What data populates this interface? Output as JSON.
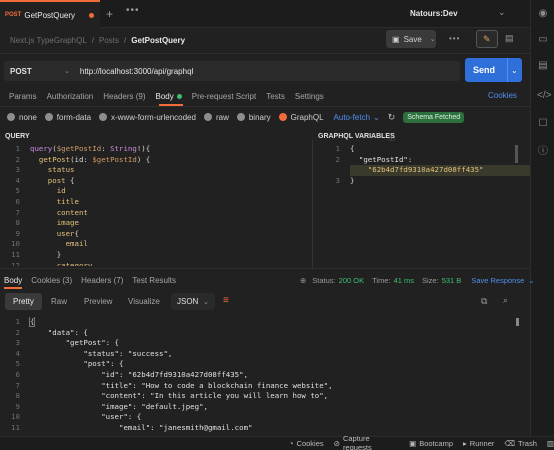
{
  "tab": {
    "method": "POST",
    "name": "GetPostQuery"
  },
  "workspace": "Natours:Dev",
  "breadcrumb": {
    "root": "Next.js TypeGraphQL",
    "folder": "Posts",
    "current": "GetPostQuery"
  },
  "save_label": "Save",
  "request": {
    "method": "POST",
    "url": "http://localhost:3000/api/graphql",
    "send_label": "Send"
  },
  "request_tabs": [
    "Params",
    "Authorization",
    "Headers (9)",
    "Body",
    "Pre-request Script",
    "Tests",
    "Settings"
  ],
  "cookies_link": "Cookies",
  "body_types": [
    "none",
    "form-data",
    "x-www-form-urlencoded",
    "raw",
    "binary",
    "GraphQL"
  ],
  "auto_fetch": "Auto-fetch",
  "schema_badge": "Schema Fetched",
  "query_title": "QUERY",
  "vars_title": "GRAPHQL VARIABLES",
  "query_lines": [
    "query($getPostId: String!){",
    "  getPost(id: $getPostId) {",
    "    status",
    "    post {",
    "      id",
    "      title",
    "      content",
    "      image",
    "      user{",
    "        email",
    "      }",
    "      category"
  ],
  "var_lines": [
    "{",
    "  \"getPostId\":",
    "    \"62b4d7fd9310a427d08ff435\"",
    "}"
  ],
  "response_tabs": [
    "Body",
    "Cookies (3)",
    "Headers (7)",
    "Test Results"
  ],
  "status": {
    "label": "Status:",
    "value": "200 OK",
    "time_label": "Time:",
    "time": "41 ms",
    "size_label": "Size:",
    "size": "531 B"
  },
  "save_response": "Save Response",
  "view_tabs": [
    "Pretty",
    "Raw",
    "Preview",
    "Visualize"
  ],
  "format": "JSON",
  "response_lines": [
    "{",
    "    \"data\": {",
    "        \"getPost\": {",
    "            \"status\": \"success\",",
    "            \"post\": {",
    "                \"id\": \"62b4d7fd9310a427d08ff435\",",
    "                \"title\": \"How to code a blockchain finance website\",",
    "                \"content\": \"In this article you will learn how to\",",
    "                \"image\": \"default.jpeg\",",
    "                \"user\": {",
    "                    \"email\": \"janesmith@gmail.com\""
  ],
  "footer": [
    "Cookies",
    "Capture requests",
    "Bootcamp",
    "Runner",
    "Trash"
  ],
  "colors": {
    "accent": "#f26b3a",
    "send": "#2f6fd9",
    "status_ok": "#3fbf6f",
    "schema_badge": "#2e6f3e"
  }
}
